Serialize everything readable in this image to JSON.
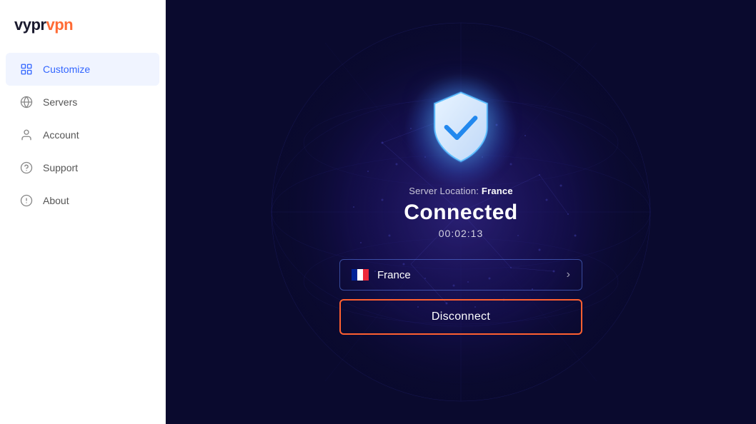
{
  "app": {
    "logo": "vyprvpn",
    "logo_accent": "vpn"
  },
  "sidebar": {
    "items": [
      {
        "id": "customize",
        "label": "Customize",
        "icon": "customize-icon",
        "active": true
      },
      {
        "id": "servers",
        "label": "Servers",
        "icon": "servers-icon",
        "active": false
      },
      {
        "id": "account",
        "label": "Account",
        "icon": "account-icon",
        "active": false
      },
      {
        "id": "support",
        "label": "Support",
        "icon": "support-icon",
        "active": false
      },
      {
        "id": "about",
        "label": "About",
        "icon": "about-icon",
        "active": false
      }
    ]
  },
  "main": {
    "server_location_prefix": "Server Location: ",
    "server_location_country": "France",
    "status": "Connected",
    "timer": "00:02:13",
    "country_name": "France",
    "disconnect_label": "Disconnect"
  }
}
